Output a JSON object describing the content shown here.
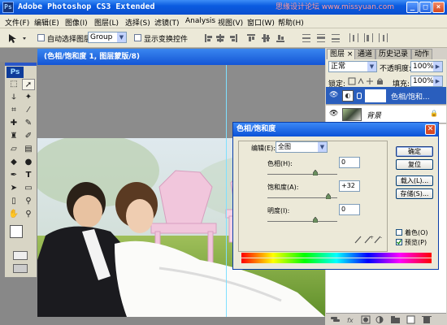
{
  "window": {
    "app_icon": "Ps",
    "title": "Adobe Photoshop CS3 Extended",
    "watermark": "思缘设计论坛 www.missyuan.com",
    "minimize": "_",
    "maximize": "□",
    "close": "×"
  },
  "menu": [
    "文件(F)",
    "编辑(E)",
    "图像(I)",
    "图层(L)",
    "选择(S)",
    "滤镜(T)",
    "Analysis",
    "视图(V)",
    "窗口(W)",
    "帮助(H)"
  ],
  "options": {
    "auto_select_label": "自动选择图层",
    "group_value": "Group",
    "show_transform_label": "显示变换控件"
  },
  "toolbox": {
    "logo": "Ps"
  },
  "document": {
    "title": "(色相/饱和度 1, 图层蒙版/8)"
  },
  "panels": {
    "tabs": [
      "图层 ×",
      "通道",
      "历史记录",
      "动作"
    ],
    "blend_mode": "正常",
    "opacity_label": "不透明度:",
    "opacity_value": "100%",
    "lock_label": "锁定:",
    "fill_label": "填充:",
    "fill_value": "100%",
    "layers": [
      {
        "name": "色相/饱和...",
        "selected": true
      },
      {
        "name": "背景",
        "selected": false
      }
    ],
    "footer_icons": [
      "link-icon",
      "fx-icon",
      "mask-icon",
      "adjustment-icon",
      "folder-icon",
      "new-layer-icon",
      "trash-icon"
    ]
  },
  "dialog": {
    "title": "色相/饱和度",
    "edit_label": "编辑(E):",
    "edit_value": "全图",
    "hue_label": "色相(H):",
    "hue_value": "0",
    "saturation_label": "饱和度(A):",
    "saturation_value": "+32",
    "lightness_label": "明度(I):",
    "lightness_value": "0",
    "buttons": [
      "确定",
      "复位",
      "载入(L)...",
      "存储(S)..."
    ],
    "colorize_label": "着色(O)",
    "preview_label": "预览(P)",
    "preview_checked": true,
    "colorize_checked": false
  },
  "colors": {
    "xp_blue": "#0b52d8",
    "panel_bg": "#d4d0c8",
    "selected_layer": "#2a5ebd",
    "close_red": "#d64a26"
  }
}
